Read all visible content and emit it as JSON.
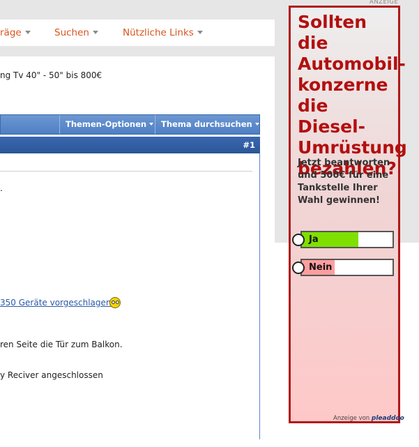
{
  "nav": {
    "items": [
      {
        "label": "räge"
      },
      {
        "label": "Suchen"
      },
      {
        "label": "Nützliche Links"
      }
    ]
  },
  "thread": {
    "title": "ng Tv 40\" - 50\" bis 800€"
  },
  "toolbar": {
    "thread_options_label": "Themen-Optionen",
    "search_thread_label": "Thema durchsuchen"
  },
  "post": {
    "number": "#1",
    "line_dot": ".",
    "link_text": "350 Geräte vorgeschlagen",
    "text_1": "ren Seite die Tür zum Balkon.",
    "text_2": "y Reciver angeschlossen"
  },
  "ad": {
    "top_label": "ANZEIGE",
    "headline": "Sollten die Automobil-konzerne die Diesel-Umrüstung bezahlen?",
    "subtext": "Jetzt beantworten und 500€ für eine Tankstelle Ihrer Wahl gewinnen!",
    "options": [
      {
        "label": "Ja",
        "share": 0.62,
        "fill_color": "#7fe000"
      },
      {
        "label": "Nein",
        "share": 0.36,
        "fill_color": "#ff9e9e"
      }
    ],
    "footer_text": "Anzeige von",
    "footer_brand": "pleaddoo",
    "border_color": "#b01818",
    "headline_color": "#b30f0f"
  }
}
